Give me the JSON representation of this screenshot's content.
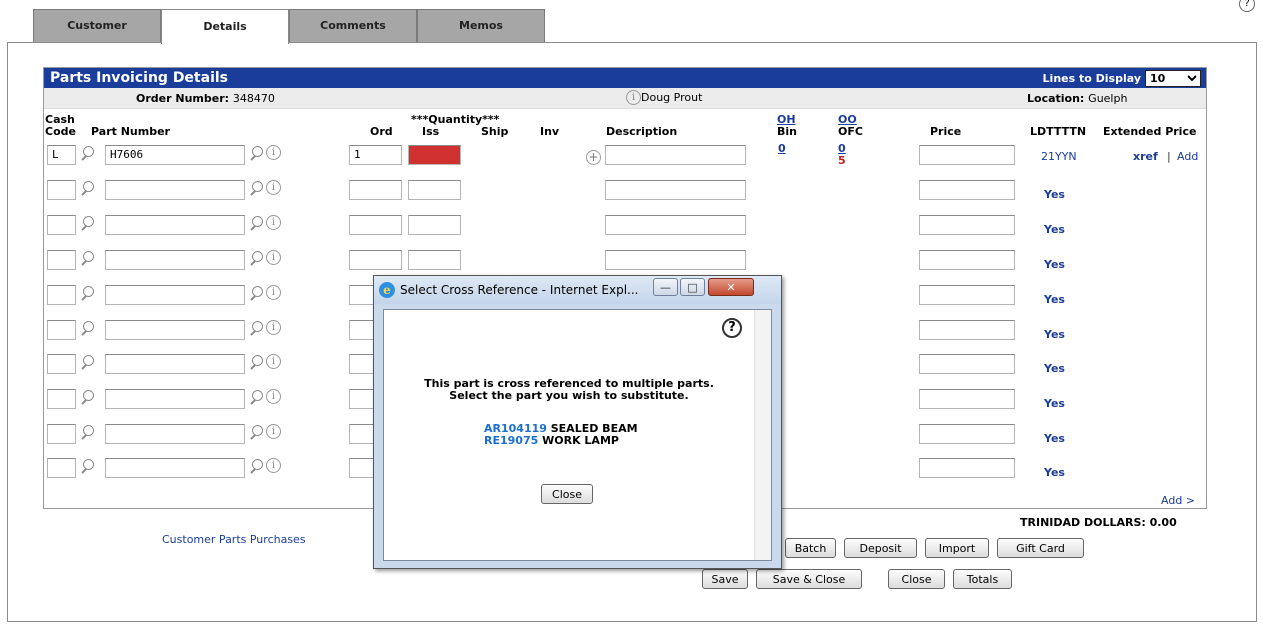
{
  "tabs": [
    {
      "label": "Customer"
    },
    {
      "label": "Details"
    },
    {
      "label": "Comments"
    },
    {
      "label": "Memos"
    }
  ],
  "panel": {
    "title": "Parts Invoicing Details",
    "lines_label": "Lines to Display",
    "lines_value": "10",
    "order_label": "Order Number:",
    "order_number": "348470",
    "user": "Doug Prout",
    "location_label": "Location:",
    "location": "Guelph"
  },
  "columns": {
    "cash_code_1": "Cash",
    "cash_code_2": "Code",
    "part_number": "Part Number",
    "quantity": "***Quantity***",
    "ord": "Ord",
    "iss": "Iss",
    "ship": "Ship",
    "inv": "Inv",
    "description": "Description",
    "oh": "OH",
    "bin": "Bin",
    "oo": "OO",
    "ofc": "OFC",
    "price": "Price",
    "ldtttn": "LDTTTTN",
    "extended_price": "Extended Price"
  },
  "first_row": {
    "cash_code": "L",
    "part_number": "H7606",
    "ord": "1",
    "iss_color": "#d03030",
    "oh_bin": "0",
    "oo": "0",
    "ofc": "5",
    "ldtttn": "21YYN",
    "xref": "xref",
    "separator": "|",
    "add": "Add"
  },
  "rows_yes": [
    "Yes",
    "Yes",
    "Yes",
    "Yes",
    "Yes",
    "Yes",
    "Yes",
    "Yes",
    "Yes"
  ],
  "add_link": "Add >",
  "total": "TRINIDAD DOLLARS: 0.00",
  "customer_parts_link": "Customer Parts Purchases",
  "buttons_row1": [
    "Batch",
    "Deposit",
    "Import",
    "Gift Card"
  ],
  "buttons_row2": [
    "Save",
    "Save & Close",
    "Close",
    "Totals"
  ],
  "popup": {
    "title": "Select Cross Reference - Internet Expl...",
    "message_line1": "This part is cross referenced to multiple parts.",
    "message_line2": "Select the part you wish to substitute.",
    "options": [
      {
        "part": "AR104119",
        "desc": "SEALED BEAM"
      },
      {
        "part": "RE19075",
        "desc": "WORK LAMP"
      }
    ],
    "close_label": "Close"
  },
  "colors": {
    "header_blue": "#1a3c9a",
    "link_blue": "#1a6fd0",
    "issue_red": "#d03030"
  }
}
